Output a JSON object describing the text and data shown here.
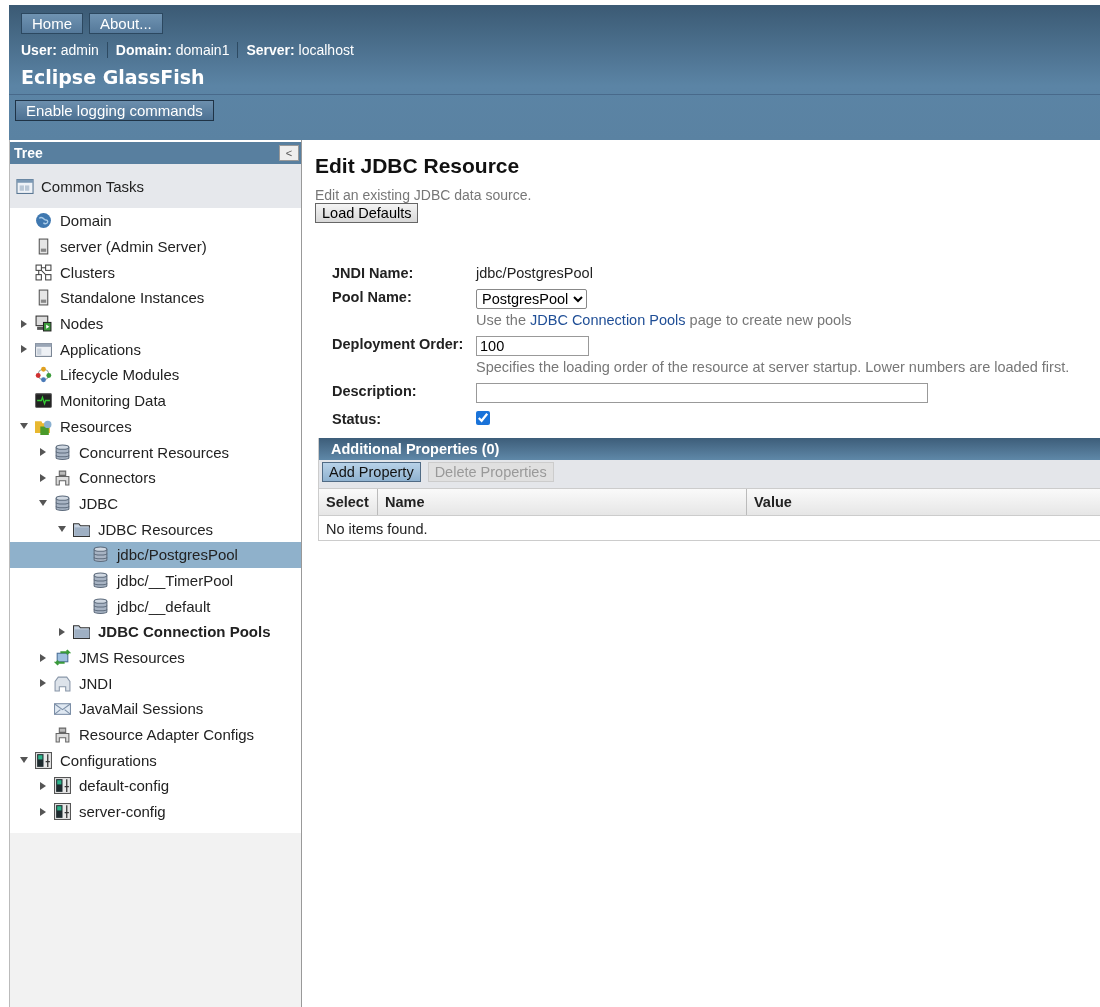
{
  "header": {
    "nav": [
      "Home",
      "About..."
    ],
    "info": [
      {
        "label": "User:",
        "value": "admin"
      },
      {
        "label": "Domain:",
        "value": "domain1"
      },
      {
        "label": "Server:",
        "value": "localhost"
      }
    ],
    "product": "Eclipse GlassFish",
    "action": "Enable logging commands"
  },
  "sidebar": {
    "title": "Tree",
    "collapse": "<",
    "common_tasks": "Common Tasks",
    "items": [
      {
        "label": "Domain",
        "kind": "globe",
        "selected": false,
        "bold": false
      },
      {
        "label": "server (Admin Server)",
        "kind": "server",
        "selected": false,
        "bold": false
      },
      {
        "label": "Clusters",
        "kind": "cluster",
        "selected": false,
        "bold": false
      },
      {
        "label": "Standalone Instances",
        "kind": "server",
        "selected": false,
        "bold": false
      },
      {
        "label": "Nodes",
        "kind": "node",
        "expanded": false,
        "selected": false,
        "bold": false
      },
      {
        "label": "Applications",
        "kind": "application",
        "expanded": false,
        "selected": false,
        "bold": false
      },
      {
        "label": "Lifecycle Modules",
        "kind": "lifecycle",
        "selected": false,
        "bold": false
      },
      {
        "label": "Monitoring Data",
        "kind": "monitor",
        "selected": false,
        "bold": false
      },
      {
        "label": "Resources",
        "kind": "resources",
        "expanded": true,
        "selected": false,
        "bold": false,
        "children": [
          {
            "label": "Concurrent Resources",
            "kind": "database",
            "expanded": false,
            "selected": false,
            "bold": false
          },
          {
            "label": "Connectors",
            "kind": "connector",
            "expanded": false,
            "selected": false,
            "bold": false
          },
          {
            "label": "JDBC",
            "kind": "database",
            "expanded": true,
            "selected": false,
            "bold": false,
            "children": [
              {
                "label": "JDBC Resources",
                "kind": "folder",
                "expanded": true,
                "selected": false,
                "bold": false,
                "children": [
                  {
                    "label": "jdbc/PostgresPool",
                    "kind": "database",
                    "selected": true,
                    "bold": false
                  },
                  {
                    "label": "jdbc/__TimerPool",
                    "kind": "database",
                    "selected": false,
                    "bold": false
                  },
                  {
                    "label": "jdbc/__default",
                    "kind": "database",
                    "selected": false,
                    "bold": false
                  }
                ]
              },
              {
                "label": "JDBC Connection Pools",
                "kind": "folder",
                "expanded": false,
                "selected": false,
                "bold": true
              }
            ]
          },
          {
            "label": "JMS Resources",
            "kind": "jms",
            "expanded": false,
            "selected": false,
            "bold": false
          },
          {
            "label": "JNDI",
            "kind": "jndi",
            "expanded": false,
            "selected": false,
            "bold": false
          },
          {
            "label": "JavaMail Sessions",
            "kind": "mail",
            "selected": false,
            "bold": false
          },
          {
            "label": "Resource Adapter Configs",
            "kind": "connector",
            "selected": false,
            "bold": false
          }
        ]
      },
      {
        "label": "Configurations",
        "kind": "config",
        "expanded": true,
        "selected": false,
        "bold": false,
        "children": [
          {
            "label": "default-config",
            "kind": "config",
            "expanded": false,
            "selected": false,
            "bold": false
          },
          {
            "label": "server-config",
            "kind": "config",
            "expanded": false,
            "selected": false,
            "bold": false
          }
        ]
      }
    ]
  },
  "main": {
    "title": "Edit JDBC Resource",
    "subtitle": "Edit an existing JDBC data source.",
    "load_defaults": "Load Defaults",
    "form": {
      "jndi_label": "JNDI Name:",
      "jndi_value": "jdbc/PostgresPool",
      "pool_label": "Pool Name:",
      "pool_value": "PostgresPool",
      "pool_help_before": "Use the",
      "pool_help_link": "JDBC Connection Pools",
      "pool_help_after": "page to create new pools",
      "order_label": "Deployment Order:",
      "order_value": "100",
      "order_help": "Specifies the loading order of the resource at server startup. Lower numbers are loaded first.",
      "description_label": "Description:",
      "status_label": "Status:",
      "status_checked": true
    },
    "properties": {
      "title": "Additional Properties (0)",
      "buttons": [
        {
          "label": "Add Property",
          "disabled": false
        },
        {
          "label": "Delete Properties",
          "disabled": true
        }
      ],
      "columns": [
        "Select",
        "Name",
        "Value"
      ],
      "empty": "No items found."
    }
  }
}
